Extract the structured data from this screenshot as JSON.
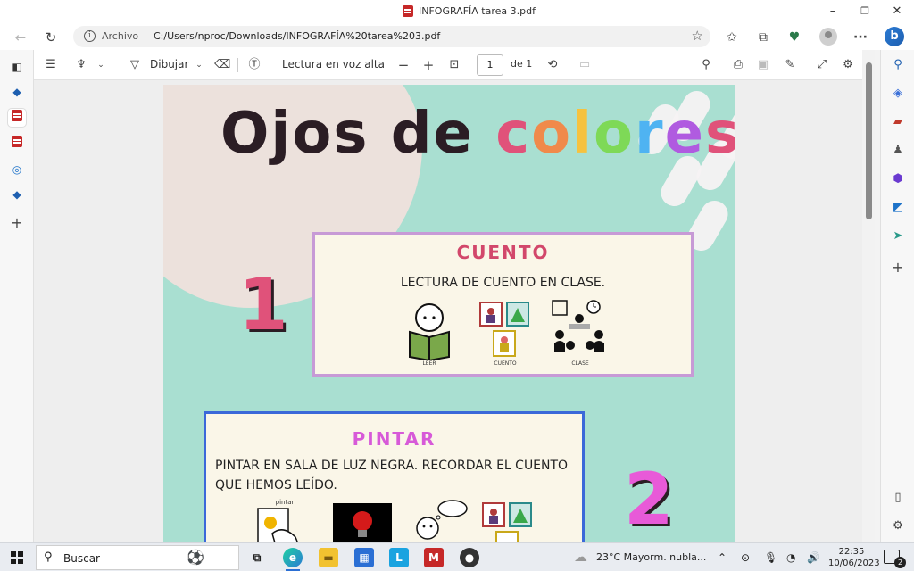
{
  "window": {
    "title": "INFOGRAFÍA tarea 3.pdf",
    "minimize": "–",
    "maximize": "❐",
    "close": "✕"
  },
  "addressbar": {
    "scheme_label": "Archivo",
    "url": "C:/Users/nproc/Downloads/INFOGRAFÍA%20tarea%203.pdf"
  },
  "pdf_toolbar": {
    "draw_label": "Dibujar",
    "read_aloud_label": "Lectura en voz alta",
    "zoom_out": "−",
    "zoom_in": "+",
    "page_current": "1",
    "page_total": "de 1"
  },
  "document": {
    "title_dark": "Ojos de ",
    "title_letters": [
      {
        "ch": "c",
        "color": "#e0527a"
      },
      {
        "ch": "o",
        "color": "#f08a4b"
      },
      {
        "ch": "l",
        "color": "#f6c23e"
      },
      {
        "ch": "o",
        "color": "#7ed957"
      },
      {
        "ch": "r",
        "color": "#4fb3f2"
      },
      {
        "ch": "e",
        "color": "#b05be0"
      },
      {
        "ch": "s",
        "color": "#e0527a"
      }
    ],
    "step1": {
      "number": "1",
      "number_color": "#e0527a",
      "title": "CUENTO",
      "title_color": "#d2476b",
      "text": "LECTURA DE CUENTO EN CLASE.",
      "pictos": [
        {
          "label": "LEER"
        },
        {
          "label": "CUENTO"
        },
        {
          "label": "CLASE"
        }
      ]
    },
    "step2": {
      "number": "2",
      "number_color": "#e85ad8",
      "title": "PINTAR",
      "title_color": "#d75ad8",
      "text_line1": "PINTAR EN SALA DE LUZ NEGRA. RECORDAR EL CUENTO",
      "text_line2": "QUE HEMOS LEÍDO.",
      "picto_caption": "pintar"
    }
  },
  "taskbar": {
    "search_label": "Buscar",
    "weather": "23°C  Mayorm. nubla...",
    "time": "22:35",
    "date": "10/06/2023",
    "notifications": "2"
  },
  "colors": {
    "page_background": "#a9dfd1",
    "card_background": "#faf6e8",
    "card1_border": "#c79ad6",
    "card2_border": "#3b68d9"
  }
}
